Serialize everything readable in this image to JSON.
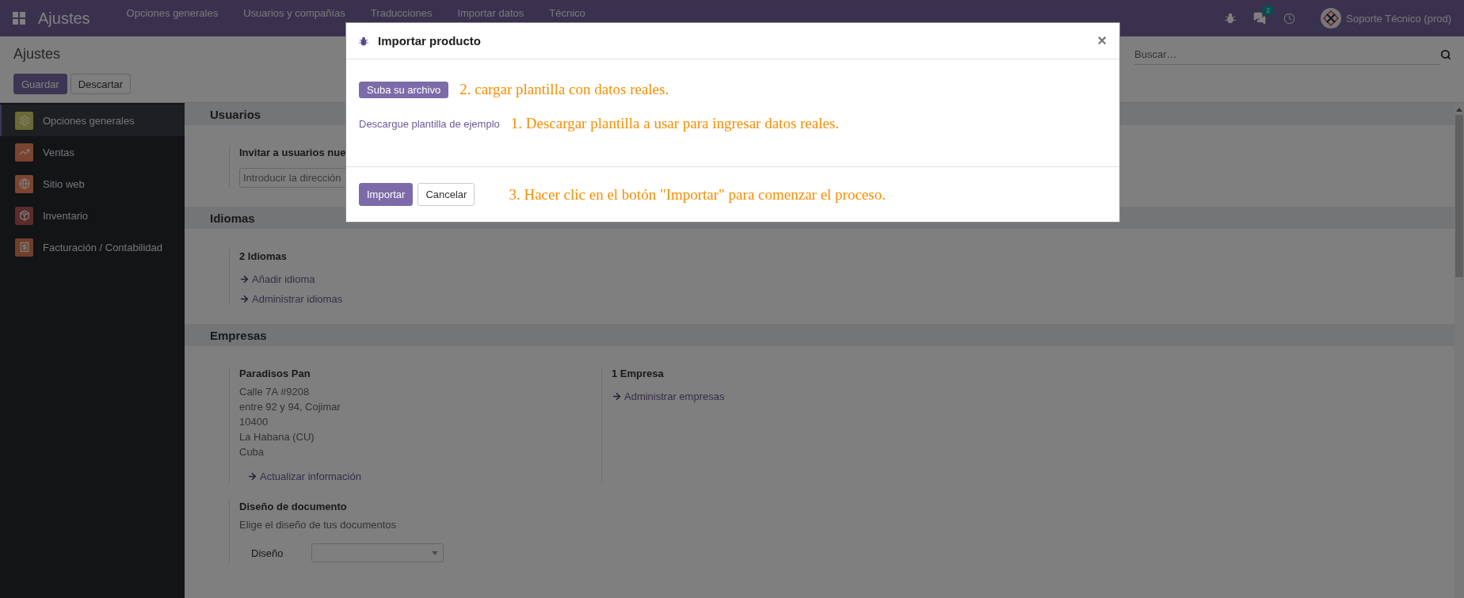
{
  "navbar": {
    "app_title": "Ajustes",
    "menu": [
      "Opciones generales",
      "Usuarios y compañías",
      "Traducciones",
      "Importar datos",
      "Técnico"
    ],
    "messages_count": "2",
    "user": "Soporte Técnico (prod)"
  },
  "control_panel": {
    "title": "Ajustes",
    "buttons": [
      {
        "label": "Guardar",
        "kind": "primary"
      },
      {
        "label": "Descartar",
        "kind": "secondary"
      }
    ],
    "search": {
      "placeholder": "Buscar…"
    }
  },
  "sidebar": {
    "items": [
      {
        "label": "Opciones generales",
        "selected": true,
        "kind": "gear",
        "color": "#6b6a36"
      },
      {
        "label": "Ventas",
        "selected": false,
        "kind": "chart",
        "color": "#7a4430"
      },
      {
        "label": "Sitio web",
        "selected": false,
        "kind": "globe",
        "color": "#7b4530"
      },
      {
        "label": "Inventario",
        "selected": false,
        "kind": "box",
        "color": "#5c2b2b"
      },
      {
        "label": "Facturación / Contabilidad",
        "selected": false,
        "kind": "invoice",
        "color": "#6f3f2a"
      }
    ]
  },
  "sections": [
    {
      "title": "Usuarios",
      "blocks": [
        {
          "kind": "invite",
          "title": "Invitar a usuarios nue",
          "placeholder": "Introducir la dirección"
        }
      ]
    },
    {
      "title": "Idiomas",
      "blocks": [
        {
          "kind": "links",
          "title": "2 Idiomas",
          "links": [
            "Añadir idioma",
            "Administrar idiomas"
          ]
        }
      ]
    },
    {
      "title": "Empresas",
      "blocks": [
        {
          "kind": "address",
          "title": "Paradisos Pan",
          "lines": [
            "Calle 7A #9208",
            "entre 92 y 94, Cojimar",
            "10400",
            "La Habana (CU)",
            "Cuba"
          ],
          "link": "Actualizar información"
        },
        {
          "kind": "links",
          "title": "1 Empresa",
          "links": [
            "Administrar empresas"
          ]
        },
        {
          "kind": "layout",
          "title": "Diseño de documento",
          "description": "Elige el diseño de tus documentos",
          "field_label": "Diseño"
        }
      ]
    }
  ],
  "modal": {
    "title": "Importar producto",
    "close": "×",
    "upload_button": "Suba su archivo",
    "upload_note": "2. cargar plantilla con datos reales.",
    "template_link": "Descargue plantilla de ejemplo",
    "template_note": "1. Descargar plantilla a usar para ingresar datos reales.",
    "buttons": [
      {
        "label": "Importar",
        "kind": "primary"
      },
      {
        "label": "Cancelar",
        "kind": "secondary"
      }
    ],
    "footer_note": "3. Hacer clic en el botón \"Importar\" para comenzar el proceso."
  }
}
